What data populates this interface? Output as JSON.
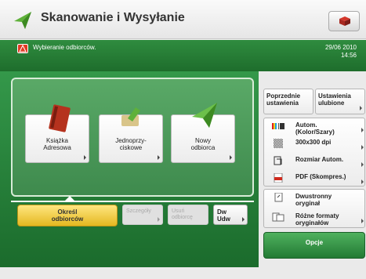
{
  "header": {
    "title": "Skanowanie i Wysyłanie"
  },
  "status": {
    "message": "Wybieranie odbiorców.",
    "date": "29/06 2010",
    "time": "14:56"
  },
  "destinations": [
    {
      "label_line1": "Książka",
      "label_line2": "Adresowa",
      "icon": "address-book-icon"
    },
    {
      "label_line1": "Jednoprzy-",
      "label_line2": "ciskowe",
      "icon": "one-touch-icon"
    },
    {
      "label_line1": "Nowy",
      "label_line2": "odbiorca",
      "icon": "paper-plane-icon"
    }
  ],
  "bottom_buttons": {
    "specify_line1": "Określ",
    "specify_line2": "odbiorców",
    "details": "Szczegóły",
    "remove_line1": "Usuń",
    "remove_line2": "odbiorcę",
    "dw_line1": "Dw",
    "dw_line2": "Udw"
  },
  "right_panel": {
    "prev_line1": "Poprzednie",
    "prev_line2": "ustawienia",
    "fav_line1": "Ustawienia",
    "fav_line2": "ulubione",
    "color_line1": "Autom.",
    "color_line2": "(Kolor/Szary)",
    "resolution": "300x300 dpi",
    "size": "Rozmiar Autom.",
    "format": "PDF (Skompres.)",
    "duplex_line1": "Dwustronny",
    "duplex_line2": "oryginał",
    "mixed_line1": "Różne formaty",
    "mixed_line2": "oryginałów",
    "options": "Opcje"
  },
  "colors": {
    "accent_green": "#1e6d2c",
    "specify_yellow": "#e5b820",
    "warning_red": "#e13a22"
  }
}
